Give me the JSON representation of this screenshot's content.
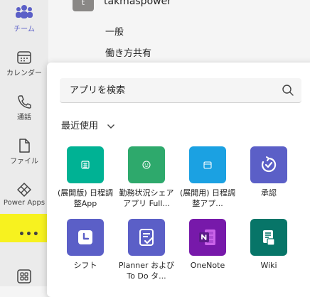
{
  "rail": {
    "items": [
      {
        "label": "チーム",
        "icon": "teams-icon"
      },
      {
        "label": "カレンダー",
        "icon": "calendar-icon"
      },
      {
        "label": "通話",
        "icon": "phone-icon"
      },
      {
        "label": "ファイル",
        "icon": "file-icon"
      },
      {
        "label": "Power Apps",
        "icon": "power-apps-icon"
      }
    ],
    "more": "•••",
    "active_color": "#5b5fc7",
    "highlight_color": "#f7f21f"
  },
  "team": {
    "avatar": "t",
    "name": "takmaspower"
  },
  "channels": [
    "一般",
    "働き方共有"
  ],
  "flyout": {
    "search_placeholder": "アプリを検索",
    "section_label": "最近使用",
    "apps": [
      {
        "name": "(展開版) 日程調整App",
        "color": "#00b294",
        "icon": "calendar-grid-icon"
      },
      {
        "name": "勤務状況シェアアプリ Full...",
        "color": "#2ea96c",
        "icon": "smiley-icon"
      },
      {
        "name": "(展開用) 日程調整アプ...",
        "color": "#1ba1e2",
        "icon": "calendar-icon"
      },
      {
        "name": "承認",
        "color": "#5b5fc7",
        "icon": "approvals-icon"
      },
      {
        "name": "シフト",
        "color": "#5b5fc7",
        "icon": "shifts-clock-icon"
      },
      {
        "name": "Planner および To Do タ...",
        "color": "#5b5fc7",
        "icon": "planner-icon"
      },
      {
        "name": "OneNote",
        "color": "#7719aa",
        "icon": "onenote-icon"
      },
      {
        "name": "Wiki",
        "color": "#077568",
        "icon": "wiki-icon"
      }
    ]
  }
}
